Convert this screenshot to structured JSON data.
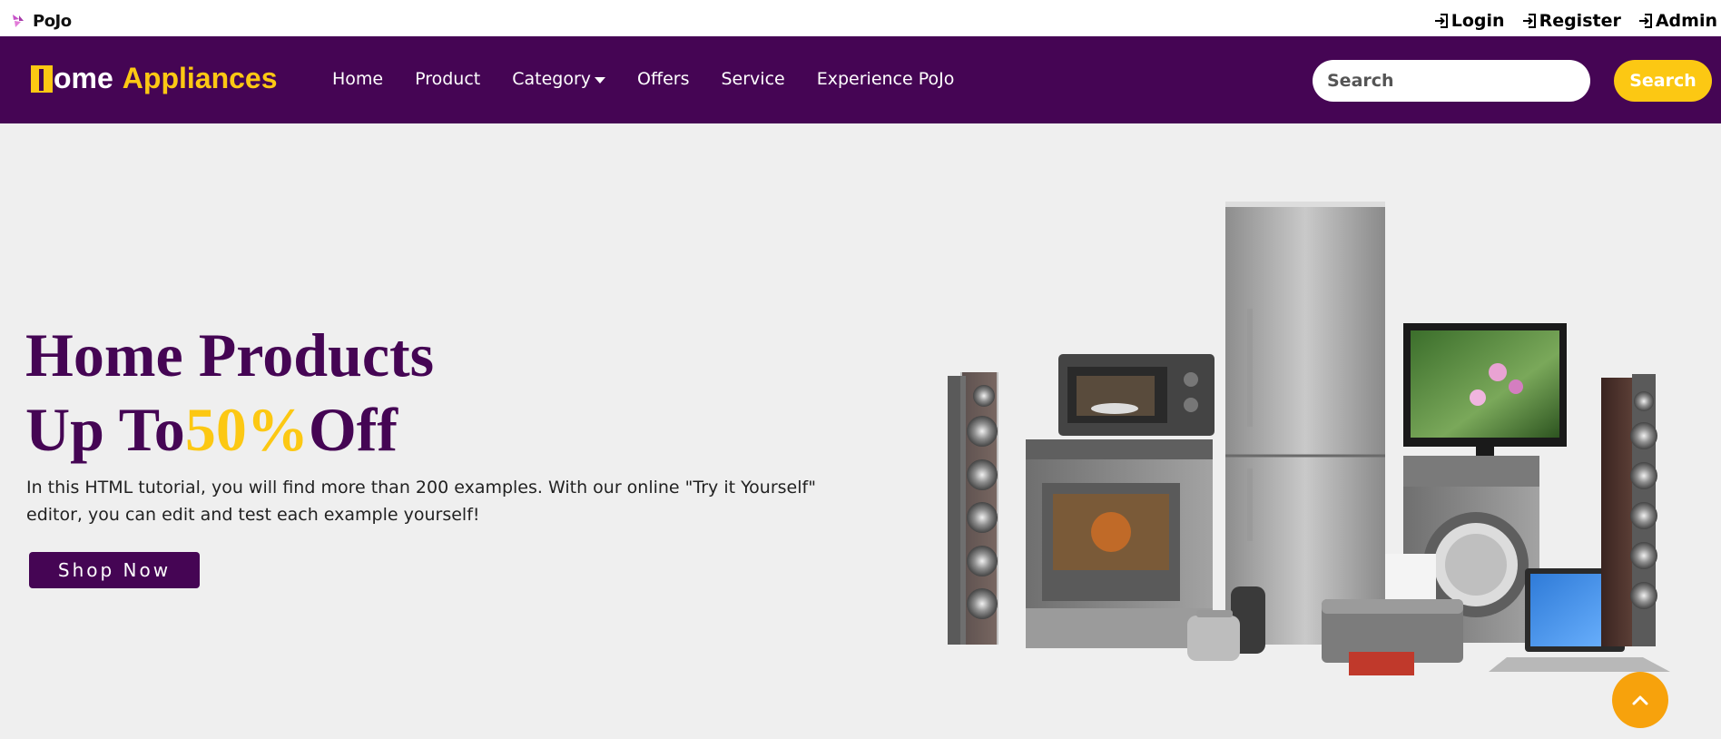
{
  "topbar": {
    "brand": "PoJo",
    "links": [
      {
        "label": "Login",
        "icon": "sign-in-icon"
      },
      {
        "label": "Register",
        "icon": "sign-in-icon"
      },
      {
        "label": "Admin",
        "icon": "sign-in-icon"
      }
    ]
  },
  "navbar": {
    "brand_first_letter": "H",
    "brand_rest": "ome",
    "brand_second": "Appliances",
    "links": [
      {
        "label": "Home"
      },
      {
        "label": "Product"
      },
      {
        "label": "Category",
        "dropdown": true
      },
      {
        "label": "Offers"
      },
      {
        "label": "Service"
      },
      {
        "label": "Experience PoJo"
      }
    ],
    "search_placeholder": "Search",
    "search_button": "Search"
  },
  "hero": {
    "line1": "Home Products",
    "line2_prefix": "Up To",
    "line2_accent": "50%",
    "line2_suffix": "Off",
    "description": "In this HTML tutorial, you will find more than 200 examples. With our online \"Try it Yourself\" editor, you can edit and test each example yourself!",
    "cta": "Shop Now"
  },
  "colors": {
    "brand_purple": "#450554",
    "accent_yellow": "#fcc813",
    "back_to_top": "#f7a20c",
    "page_bg": "#efefef"
  },
  "icons": {
    "back_to_top": "chevron-up-icon"
  }
}
